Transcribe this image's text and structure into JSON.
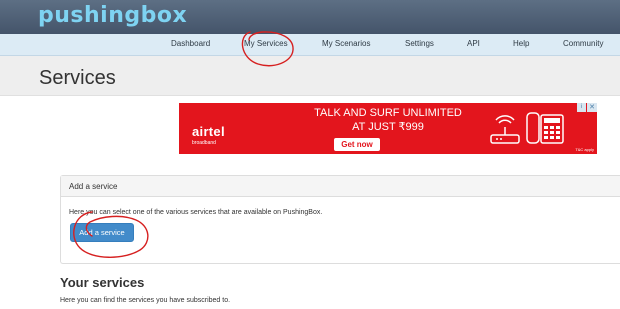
{
  "brand": {
    "logo_text": "pushingbox"
  },
  "nav": {
    "items": [
      "Dashboard",
      "My Services",
      "My Scenarios",
      "Settings",
      "API",
      "Help",
      "Community"
    ]
  },
  "header": {
    "title": "Services"
  },
  "ad": {
    "brand": "airtel",
    "brand_sub": "broadband",
    "headline": "TALK AND SURF UNLIMITED",
    "headline2": "AT JUST ₹999",
    "cta": "Get now",
    "fine_print": "T&C apply",
    "color": "#e3151d",
    "close_icon": "close-icon",
    "info_icon": "info-icon"
  },
  "add_service": {
    "title": "Add a service",
    "description": "Here you can select one of the various services that are available on PushingBox.",
    "button_label": "Add a service"
  },
  "your_services": {
    "title": "Your services",
    "description": "Here you can find the services you have subscribed to."
  },
  "colors": {
    "brandbar": "#4e5f75",
    "navbar": "#dcebf5",
    "primary_button": "#428bca",
    "annotation": "#d62020"
  }
}
